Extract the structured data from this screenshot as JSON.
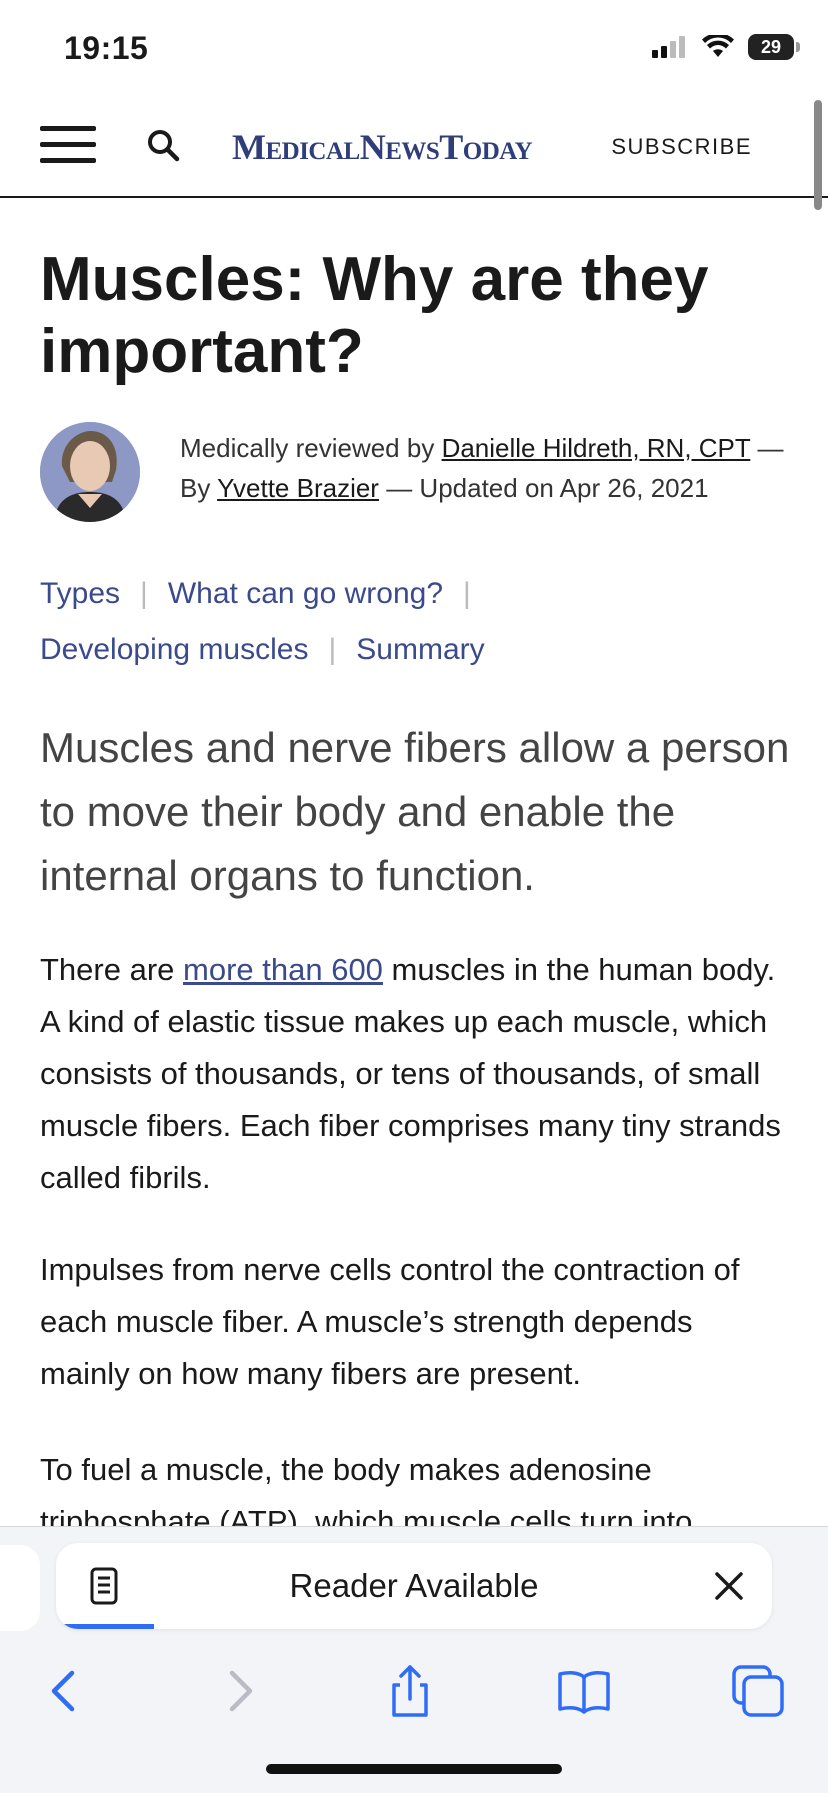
{
  "status_bar": {
    "time": "19:15",
    "battery": "29"
  },
  "header": {
    "brand": "MedicalNewsToday",
    "subscribe": "SUBSCRIBE"
  },
  "article": {
    "title": "Muscles: Why are they important?",
    "byline": {
      "reviewed_prefix": "Medically reviewed by ",
      "reviewer": "Danielle Hildreth, RN, CPT",
      "by_prefix": " — By ",
      "author": "Yvette Brazier",
      "updated": " — Updated on Apr 26, 2021"
    },
    "toc": [
      "Types",
      "What can go wrong?",
      "Developing muscles",
      "Summary"
    ],
    "lead": "Muscles and nerve fibers allow a person to move their body and enable the internal organs to function.",
    "p1": {
      "before": "There are ",
      "link": "more than 600",
      "after": " muscles in the human body. A kind of elastic tissue makes up each muscle, which consists of thousands, or tens of thousands, of small muscle fibers. Each fiber comprises many tiny strands called fibrils."
    },
    "p2": "Impulses from nerve cells control the contraction of each muscle fiber. A muscle’s strength depends mainly on how many fibers are present.",
    "p3": "To fuel a muscle, the body makes adenosine triphosphate (ATP), which muscle cells turn into"
  },
  "safari": {
    "reader_label": "Reader Available",
    "icons": [
      "reader-icon",
      "close-icon",
      "back-icon",
      "forward-icon",
      "share-icon",
      "bookmarks-icon",
      "tabs-icon"
    ],
    "accent": "#2f6df6"
  },
  "colors": {
    "link": "#3b4a8c",
    "brand": "#2f3d7a"
  }
}
